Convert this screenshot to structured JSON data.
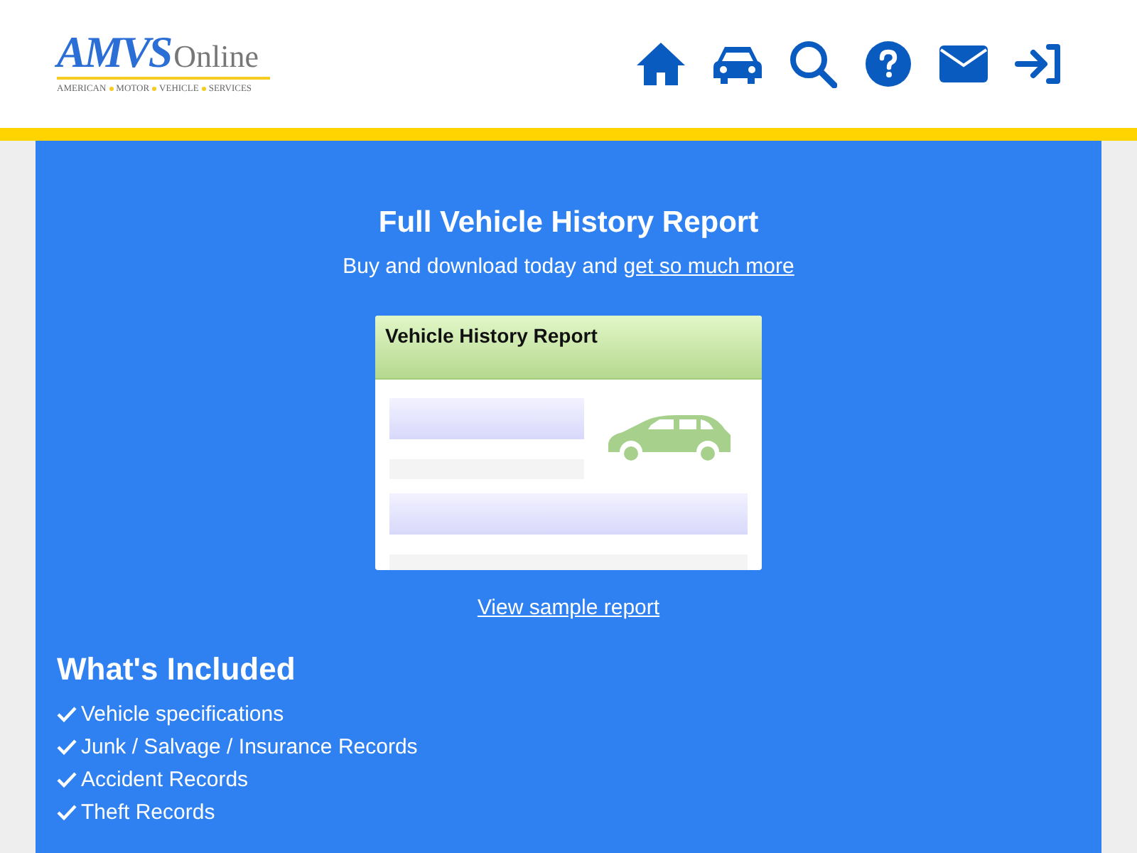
{
  "logo": {
    "brand": "AMVS",
    "suffix": "Online",
    "tagline": [
      "AMERICAN",
      "MOTOR",
      "VEHICLE",
      "SERVICES"
    ]
  },
  "nav": [
    {
      "kind": "home"
    },
    {
      "kind": "car"
    },
    {
      "kind": "search"
    },
    {
      "kind": "help"
    },
    {
      "kind": "mail"
    },
    {
      "kind": "login"
    }
  ],
  "hero": {
    "title": "Full Vehicle History Report",
    "subtitle": "Buy and download today and",
    "subtitle_link": "get so much more",
    "preview_title": "Vehicle History Report",
    "sample_link": "View sample report"
  },
  "included": {
    "heading": "What's Included",
    "items": [
      "Vehicle specifications",
      "Junk / Salvage / Insurance Records",
      "Accident Records",
      "Theft Records"
    ]
  }
}
